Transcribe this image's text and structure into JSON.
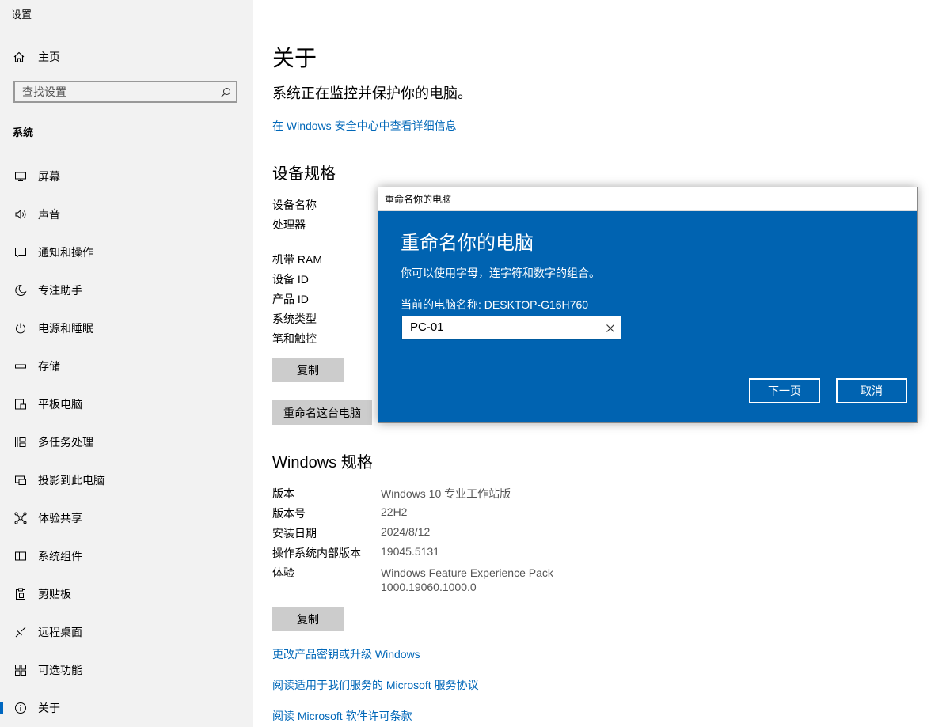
{
  "app": {
    "title": "设置"
  },
  "sidebar": {
    "home_label": "主页",
    "search_placeholder": "查找设置",
    "section": "系统",
    "items": [
      {
        "label": "屏幕",
        "icon": "monitor-icon"
      },
      {
        "label": "声音",
        "icon": "speaker-icon"
      },
      {
        "label": "通知和操作",
        "icon": "notification-icon"
      },
      {
        "label": "专注助手",
        "icon": "moon-icon"
      },
      {
        "label": "电源和睡眠",
        "icon": "power-icon"
      },
      {
        "label": "存储",
        "icon": "storage-icon"
      },
      {
        "label": "平板电脑",
        "icon": "tablet-icon"
      },
      {
        "label": "多任务处理",
        "icon": "multitasking-icon"
      },
      {
        "label": "投影到此电脑",
        "icon": "projection-icon"
      },
      {
        "label": "体验共享",
        "icon": "share-icon"
      },
      {
        "label": "系统组件",
        "icon": "components-icon"
      },
      {
        "label": "剪贴板",
        "icon": "clipboard-icon"
      },
      {
        "label": "远程桌面",
        "icon": "remote-desktop-icon"
      },
      {
        "label": "可选功能",
        "icon": "optional-features-icon"
      },
      {
        "label": "关于",
        "icon": "info-icon",
        "active": true
      }
    ]
  },
  "main": {
    "title": "关于",
    "status": "系统正在监控并保护你的电脑。",
    "security_link": "在 Windows 安全中心中查看详细信息",
    "device_specs": {
      "heading": "设备规格",
      "rows": [
        {
          "label": "设备名称"
        },
        {
          "label": "处理器"
        },
        {
          "label": "机带 RAM"
        },
        {
          "label": "设备 ID"
        },
        {
          "label": "产品 ID"
        },
        {
          "label": "系统类型"
        },
        {
          "label": "笔和触控"
        }
      ],
      "copy_label": "复制",
      "rename_label": "重命名这台电脑"
    },
    "windows_specs": {
      "heading": "Windows 规格",
      "rows": [
        {
          "label": "版本",
          "value": "Windows 10 专业工作站版"
        },
        {
          "label": "版本号",
          "value": "22H2"
        },
        {
          "label": "安装日期",
          "value": "2024/8/12"
        },
        {
          "label": "操作系统内部版本",
          "value": "19045.5131"
        },
        {
          "label": "体验",
          "value": "Windows Feature Experience Pack",
          "value2": "1000.19060.1000.0"
        }
      ],
      "copy_label": "复制"
    },
    "links": [
      "更改产品密钥或升级 Windows",
      "阅读适用于我们服务的 Microsoft 服务协议",
      "阅读 Microsoft 软件许可条款"
    ]
  },
  "dialog": {
    "window_title": "重命名你的电脑",
    "heading": "重命名你的电脑",
    "description": "你可以使用字母，连字符和数字的组合。",
    "current_name": "当前的电脑名称: DESKTOP-G16H760",
    "input_value": "PC-01",
    "next_label": "下一页",
    "cancel_label": "取消"
  },
  "colors": {
    "sidebar_bg": "#f2f2f2",
    "link": "#0067b8",
    "dialog_bg": "#0063b1",
    "accent": "#0067c0"
  }
}
